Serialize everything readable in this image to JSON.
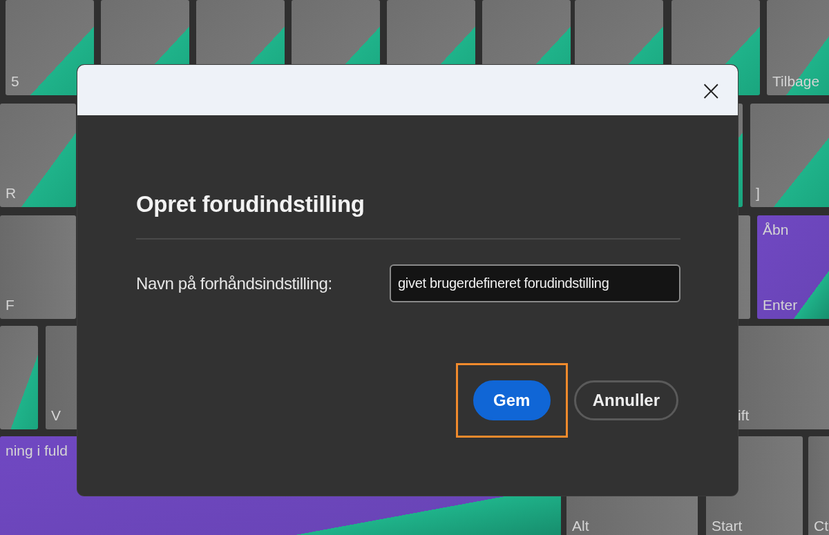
{
  "keyboard": {
    "keys": [
      {
        "kind": "green",
        "label": "5"
      },
      {
        "kind": "green"
      },
      {
        "kind": "green"
      },
      {
        "kind": "green"
      },
      {
        "kind": "green"
      },
      {
        "kind": "green"
      },
      {
        "kind": "green"
      },
      {
        "kind": "green"
      },
      {
        "kind": "green",
        "label": "Tilbage"
      },
      {
        "kind": "green",
        "label": "R"
      },
      {
        "kind": "green"
      },
      {
        "kind": "green",
        "label": "]"
      },
      {
        "kind": "plain",
        "label": "F"
      },
      {
        "kind": "plain"
      },
      {
        "kind": "purple",
        "top_label": "Åbn",
        "label": "Enter"
      },
      {
        "kind": "green"
      },
      {
        "kind": "plain",
        "label": "V"
      },
      {
        "kind": "plain",
        "label": "ift"
      },
      {
        "kind": "purple",
        "top_label": "ning i fuld"
      },
      {
        "kind": "plain",
        "label": "Alt"
      },
      {
        "kind": "plain",
        "label": "Start"
      },
      {
        "kind": "plain",
        "label": "Ct"
      }
    ]
  },
  "dialog": {
    "close": "×",
    "title": "Opret forudindstilling",
    "field_label": "Navn på forhåndsindstilling:",
    "field_value": "givet brugerdefineret forudindstilling",
    "buttons": [
      {
        "label": "Gem",
        "kind": "primary",
        "highlighted": true
      },
      {
        "label": "Annuller",
        "kind": "secondary",
        "highlighted": false
      }
    ]
  }
}
